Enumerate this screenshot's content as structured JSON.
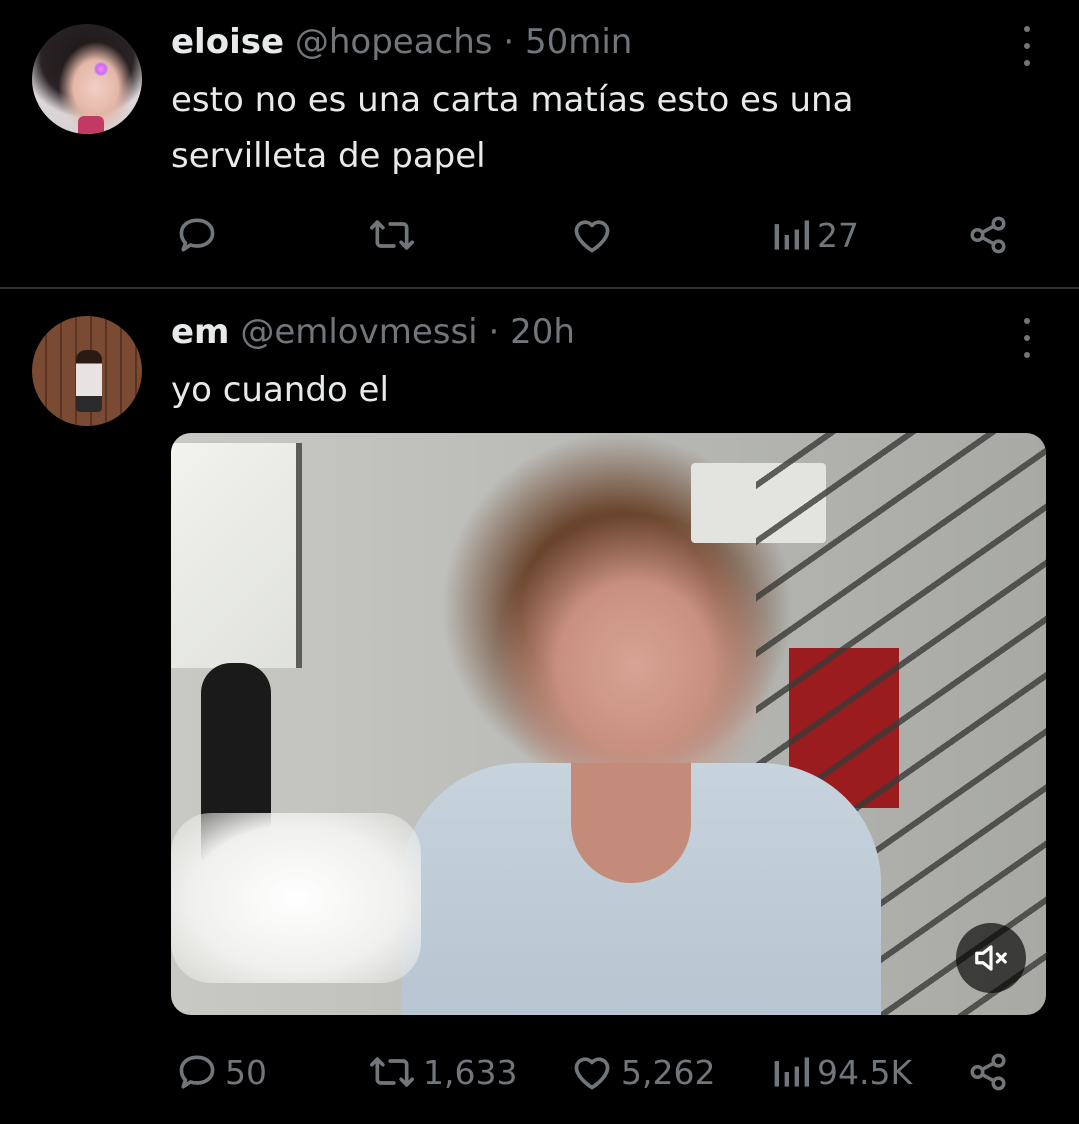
{
  "tweets": [
    {
      "name": "eloise",
      "handle": "@hopeachs",
      "separator": "·",
      "time": "50min",
      "text": "esto no es una carta matías esto es una\nservilleta de papel",
      "actions": {
        "reply_count": "",
        "retweet_count": "",
        "like_count": "",
        "views_count": "27"
      }
    },
    {
      "name": "em",
      "handle": "@emlovmessi",
      "separator": "·",
      "time": "20h",
      "text": "yo cuando el",
      "actions": {
        "reply_count": "50",
        "retweet_count": "1,633",
        "like_count": "5,262",
        "views_count": "94.5K"
      }
    }
  ],
  "colors": {
    "background": "#000000",
    "text_primary": "#e7e9ea",
    "text_secondary": "#71767b",
    "divider": "#2f3336"
  },
  "icons": [
    "reply-icon",
    "retweet-icon",
    "like-icon",
    "views-icon",
    "share-icon",
    "more-icon",
    "volume-muted-icon"
  ]
}
